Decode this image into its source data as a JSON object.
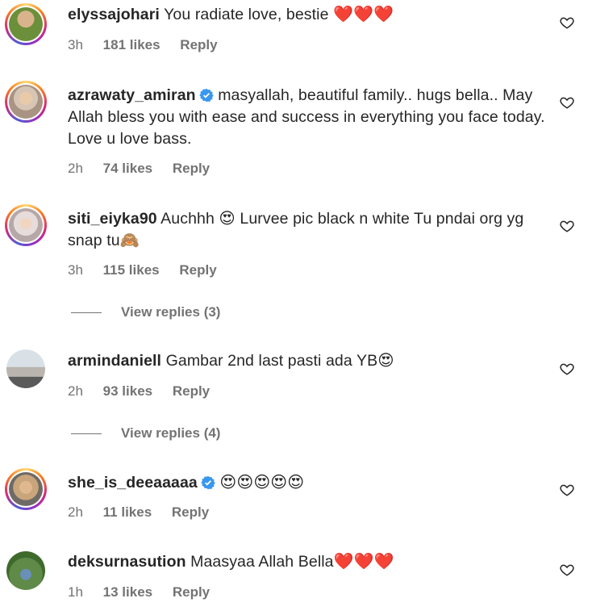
{
  "comments": [
    {
      "user": "elyssajohari",
      "text": "You radiate love, bestie",
      "emoji": "❤️❤️❤️",
      "time": "3h",
      "likes": "181 likes",
      "reply": "Reply"
    },
    {
      "user": "azrawaty_amiran",
      "text": "masyallah, beautiful family.. hugs bella.. May Allah bless you with ease and success in everything you face today. Love u love bass.",
      "emoji": "",
      "time": "2h",
      "likes": "74 likes",
      "reply": "Reply"
    },
    {
      "user": "siti_eiyka90",
      "text": "Auchhh 😍 Lurvee pic black n white Tu pndai org yg snap tu🙈",
      "emoji": "",
      "time": "3h",
      "likes": "115 likes",
      "reply": "Reply",
      "view_replies": "View replies (3)"
    },
    {
      "user": "armindaniell",
      "text": "Gambar 2nd last pasti ada YB😍",
      "emoji": "",
      "time": "2h",
      "likes": "93 likes",
      "reply": "Reply",
      "view_replies": "View replies (4)"
    },
    {
      "user": "she_is_deeaaaaa",
      "text": "",
      "emoji": "😍😍😍😍😍",
      "time": "2h",
      "likes": "11 likes",
      "reply": "Reply"
    },
    {
      "user": "deksurnasution",
      "text": "Maasyaa Allah Bella",
      "emoji": "❤️❤️❤️",
      "time": "1h",
      "likes": "13 likes",
      "reply": "Reply"
    }
  ],
  "icons": {
    "like": "heart-outline-icon",
    "verified": "verified-badge-icon"
  },
  "colors": {
    "verified": "#3897f0",
    "secondary": "#737373",
    "text": "#262626"
  }
}
